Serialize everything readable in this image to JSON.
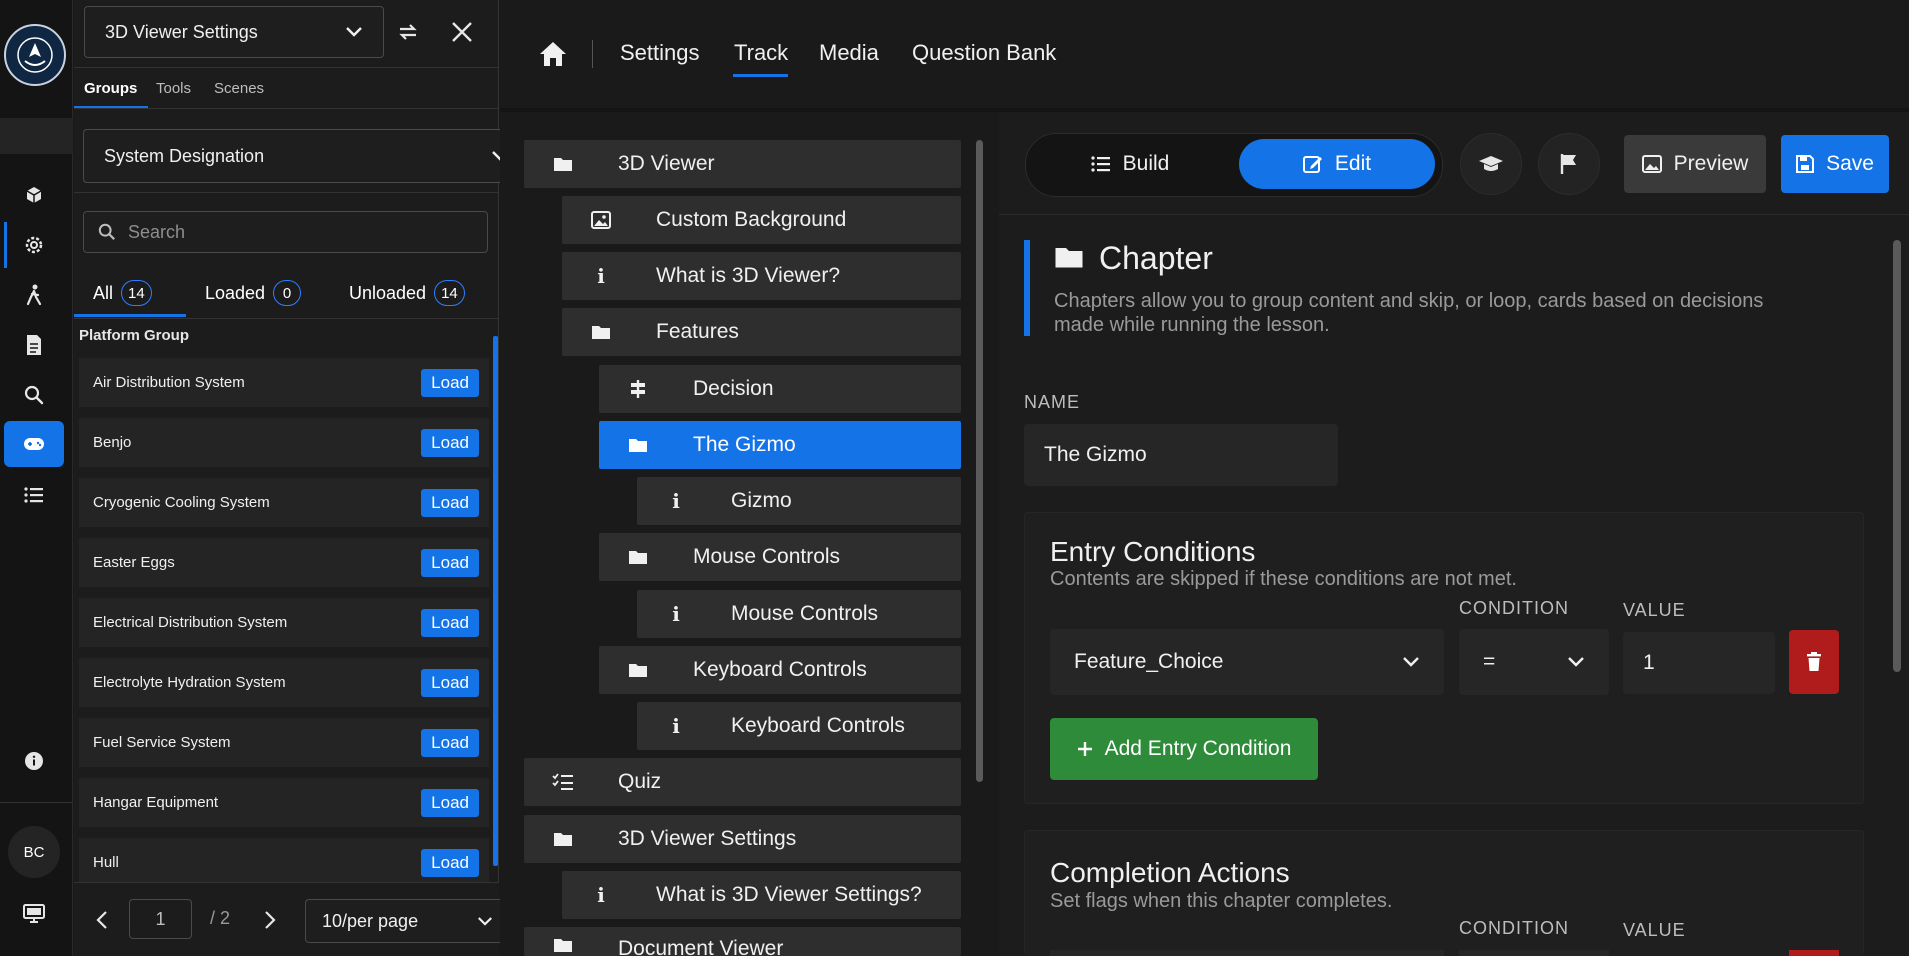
{
  "library": {
    "title": "3D Viewer Settings",
    "tabs": [
      "Groups",
      "Tools",
      "Scenes"
    ],
    "group_select": "System Designation",
    "search_placeholder": "Search",
    "filters": [
      {
        "label": "All",
        "count": "14"
      },
      {
        "label": "Loaded",
        "count": "0"
      },
      {
        "label": "Unloaded",
        "count": "14"
      }
    ],
    "group_heading": "Platform Group",
    "items": [
      {
        "name": "Air Distribution System",
        "action": "Load"
      },
      {
        "name": "Benjo",
        "action": "Load"
      },
      {
        "name": "Cryogenic Cooling System",
        "action": "Load"
      },
      {
        "name": "Easter Eggs",
        "action": "Load"
      },
      {
        "name": "Electrical Distribution System",
        "action": "Load"
      },
      {
        "name": "Electrolyte Hydration System",
        "action": "Load"
      },
      {
        "name": "Fuel Service System",
        "action": "Load"
      },
      {
        "name": "Hangar Equipment",
        "action": "Load"
      },
      {
        "name": "Hull",
        "action": "Load"
      }
    ],
    "pagination": {
      "page": "1",
      "total": "/ 2",
      "per_page": "10/per page"
    }
  },
  "rail": {
    "avatar": "BC"
  },
  "topnav": {
    "links": [
      "Settings",
      "Track",
      "Media",
      "Question Bank"
    ],
    "active": "Track"
  },
  "tree": [
    {
      "label": "3D Viewer",
      "icon": "folder-icon"
    },
    {
      "label": "Custom Background",
      "icon": "image-icon"
    },
    {
      "label": "What is 3D Viewer?",
      "icon": "info-icon"
    },
    {
      "label": "Features",
      "icon": "folder-icon"
    },
    {
      "label": "Decision",
      "icon": "decision-icon"
    },
    {
      "label": "The Gizmo",
      "icon": "folder-icon"
    },
    {
      "label": "Gizmo",
      "icon": "info-icon"
    },
    {
      "label": "Mouse Controls",
      "icon": "folder-icon"
    },
    {
      "label": "Mouse Controls",
      "icon": "info-icon"
    },
    {
      "label": "Keyboard Controls",
      "icon": "folder-icon"
    },
    {
      "label": "Keyboard Controls",
      "icon": "info-icon"
    },
    {
      "label": "Quiz",
      "icon": "quiz-icon"
    },
    {
      "label": "3D Viewer Settings",
      "icon": "folder-icon"
    },
    {
      "label": "What is 3D Viewer Settings?",
      "icon": "info-icon"
    },
    {
      "label": "Document Viewer",
      "icon": "folder-icon"
    }
  ],
  "toolbar": {
    "build": "Build",
    "edit": "Edit",
    "preview": "Preview",
    "save": "Save"
  },
  "chapter": {
    "title": "Chapter",
    "description": "Chapters allow you to group content and skip, or loop, cards based on decisions made while running the lesson.",
    "name_label": "NAME",
    "name_value": "The Gizmo"
  },
  "entry": {
    "title": "Entry Conditions",
    "subtitle": "Contents are skipped if these conditions are not met.",
    "condition_label": "CONDITION",
    "value_label": "VALUE",
    "variable": "Feature_Choice",
    "operator": "=",
    "value": "1",
    "add_button": "Add Entry Condition"
  },
  "completion": {
    "title": "Completion Actions",
    "subtitle": "Set flags when this chapter completes.",
    "condition_label": "CONDITION",
    "value_label": "VALUE"
  },
  "colors": {
    "accent": "#1473e6",
    "success": "#2e8b3a",
    "danger": "#b01c1c"
  }
}
